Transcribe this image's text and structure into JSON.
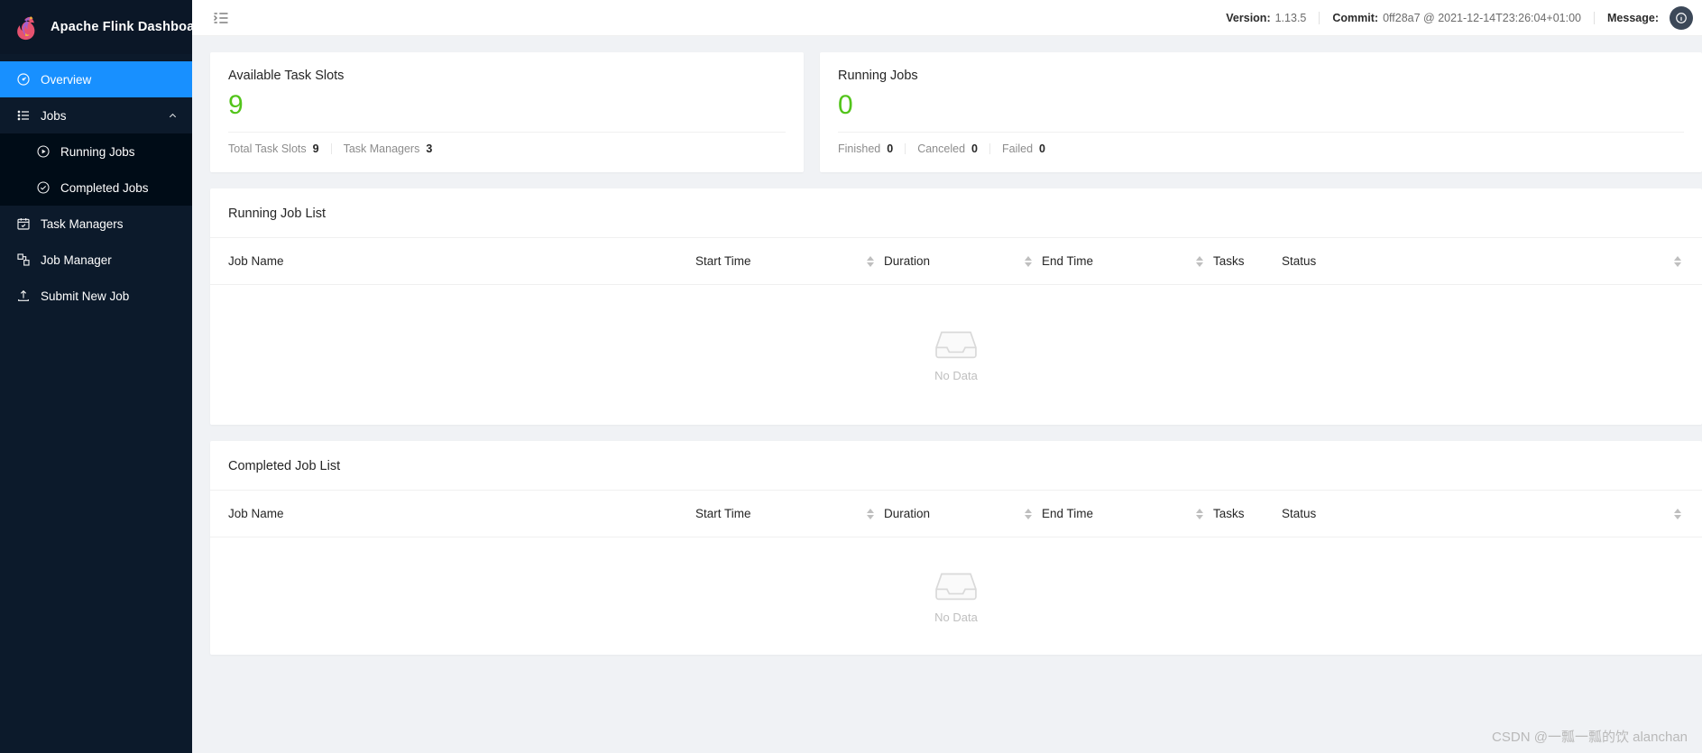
{
  "brand": {
    "title": "Apache Flink Dashboard",
    "logo_icon": "flink-squirrel-logo"
  },
  "sidebar": {
    "items": [
      {
        "label": "Overview",
        "icon": "dashboard-icon",
        "active": true
      },
      {
        "label": "Jobs",
        "icon": "list-icon",
        "active": false
      },
      {
        "label": "Running Jobs",
        "icon": "play-circle-icon",
        "active": false
      },
      {
        "label": "Completed Jobs",
        "icon": "check-circle-icon",
        "active": false
      },
      {
        "label": "Task Managers",
        "icon": "calendar-check-icon",
        "active": false
      },
      {
        "label": "Job Manager",
        "icon": "cluster-icon",
        "active": false
      },
      {
        "label": "Submit New Job",
        "icon": "upload-icon",
        "active": false
      }
    ]
  },
  "topbar": {
    "collapse_icon": "menu-fold-icon",
    "version_label": "Version:",
    "version_value": "1.13.5",
    "commit_label": "Commit:",
    "commit_value": "0ff28a7 @ 2021-12-14T23:26:04+01:00",
    "message_label": "Message:",
    "avatar_icon": "message-badge-icon"
  },
  "cards": {
    "slots": {
      "title": "Available Task Slots",
      "value": "9",
      "value_color": "#52c41a",
      "stats": [
        {
          "label": "Total Task Slots",
          "value": "9"
        },
        {
          "label": "Task Managers",
          "value": "3"
        }
      ]
    },
    "jobs": {
      "title": "Running Jobs",
      "value": "0",
      "value_color": "#52c41a",
      "stats": [
        {
          "label": "Finished",
          "value": "0"
        },
        {
          "label": "Canceled",
          "value": "0"
        },
        {
          "label": "Failed",
          "value": "0"
        }
      ]
    }
  },
  "tables": {
    "columns": {
      "job_name": "Job Name",
      "start_time": "Start Time",
      "duration": "Duration",
      "end_time": "End Time",
      "tasks": "Tasks",
      "status": "Status"
    },
    "empty_text": "No Data",
    "empty_icon": "inbox-icon",
    "running": {
      "title": "Running Job List",
      "rows": []
    },
    "completed": {
      "title": "Completed Job List",
      "rows": []
    }
  },
  "watermark": {
    "text": "CSDN @一瓢一瓢的饮 alanchan"
  }
}
